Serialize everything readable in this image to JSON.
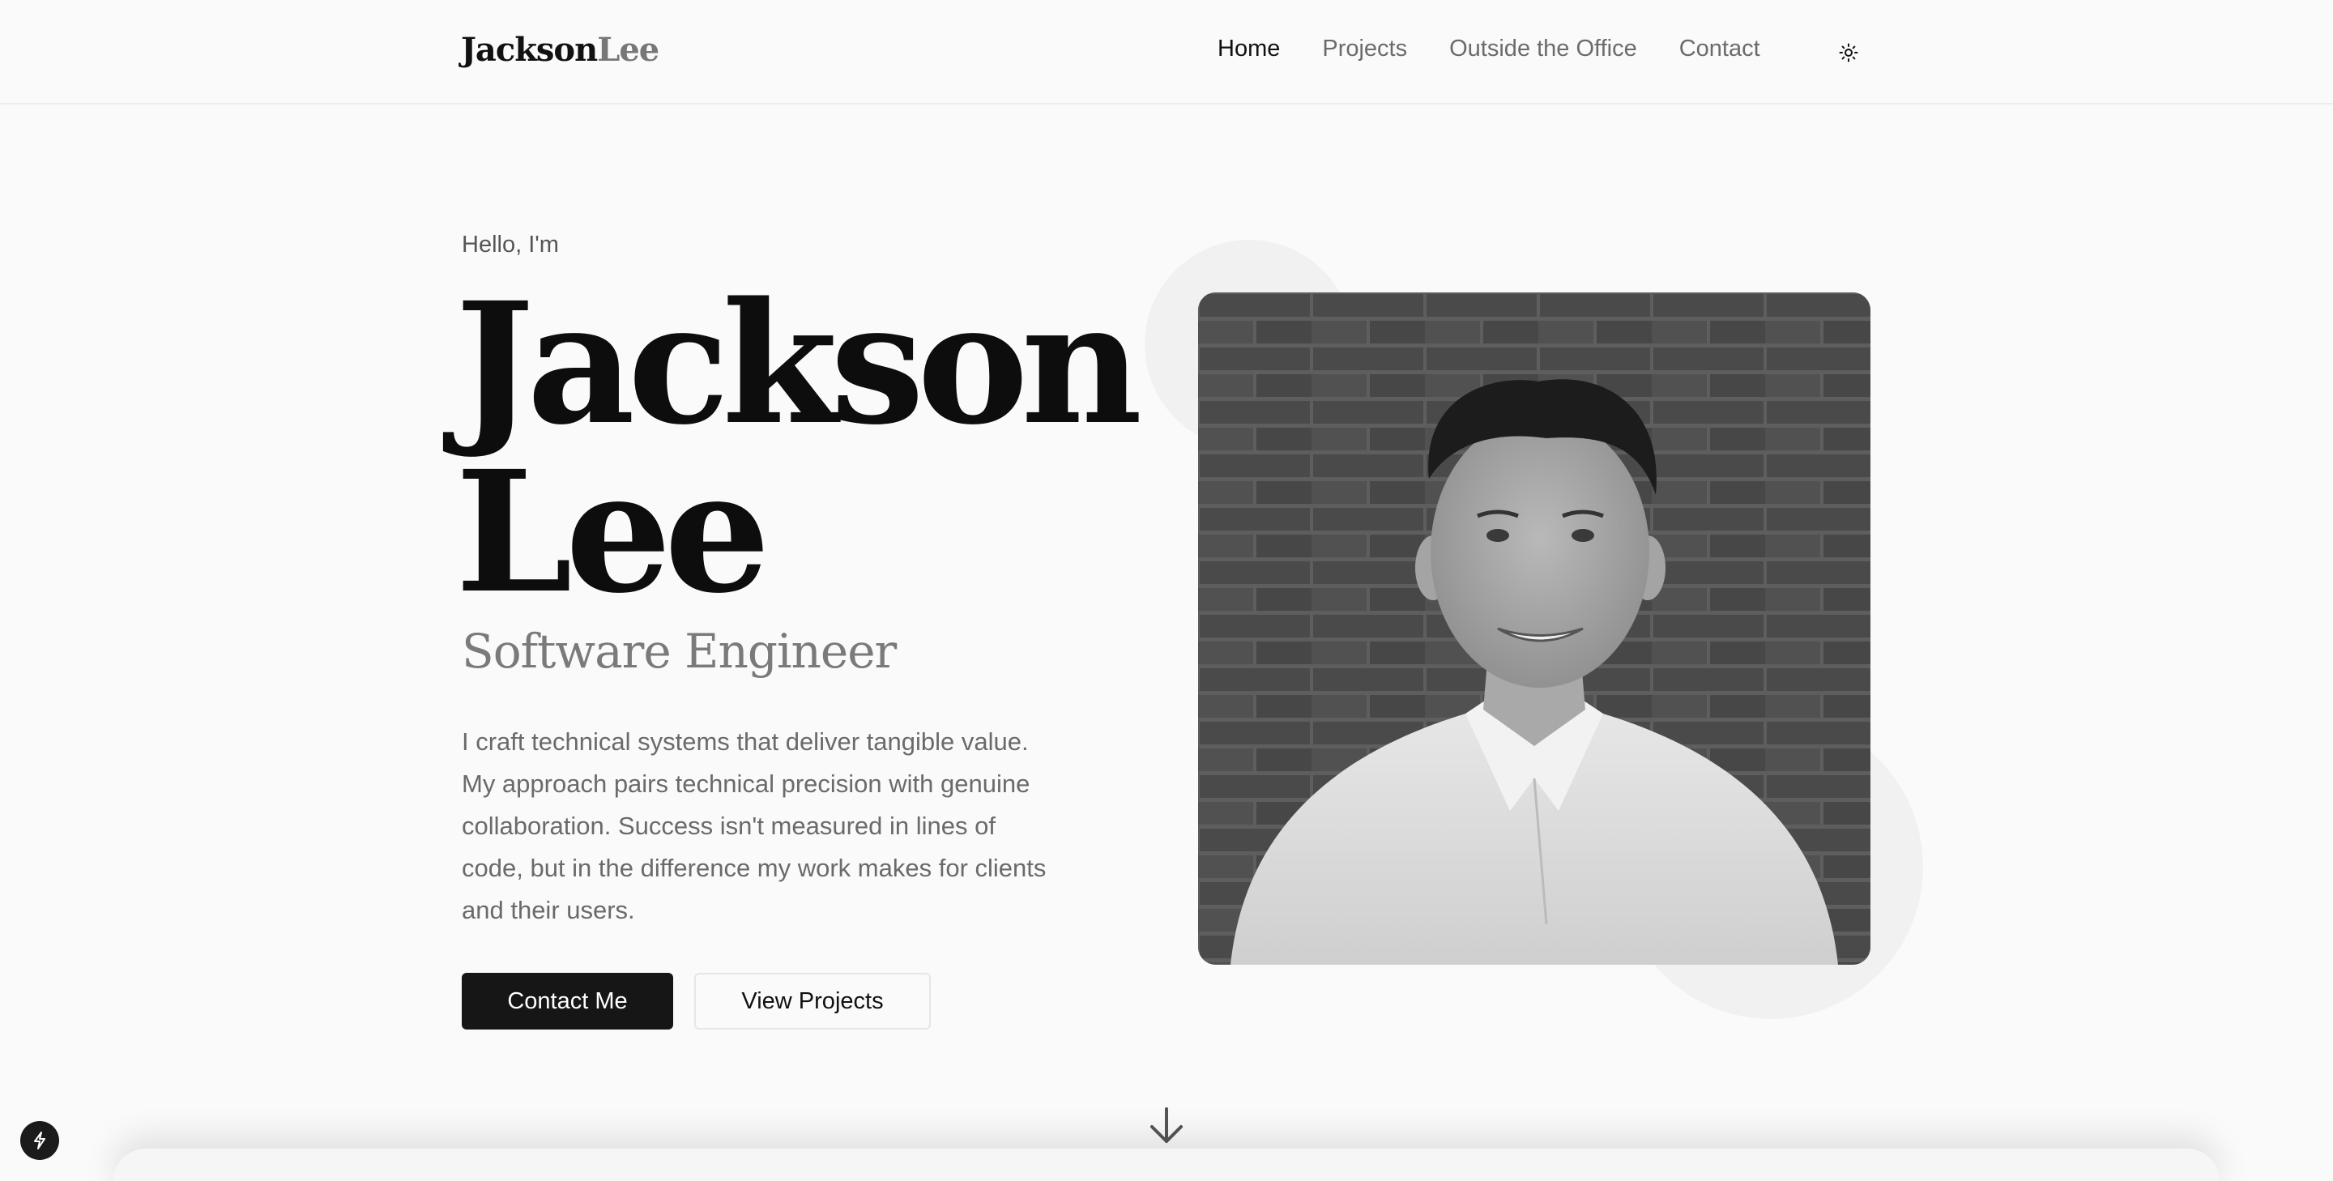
{
  "header": {
    "logo_first": "Jackson",
    "logo_last": "Lee",
    "nav": [
      {
        "label": "Home",
        "active": true
      },
      {
        "label": "Projects",
        "active": false
      },
      {
        "label": "Outside the Office",
        "active": false
      },
      {
        "label": "Contact",
        "active": false
      }
    ],
    "theme_icon": "sun-icon"
  },
  "hero": {
    "greeting": "Hello, I'm",
    "name_line1": "Jackson",
    "name_line2": "Lee",
    "role": "Software Engineer",
    "bio": "I craft technical systems that deliver tangible value. My approach pairs technical precision with genuine collaboration. Success isn't measured in lines of code, but in the difference my work makes for clients and their users.",
    "primary_cta": "Contact Me",
    "secondary_cta": "View Projects",
    "photo_alt": "Jackson Lee portrait"
  },
  "scroll_icon": "arrow-down-icon",
  "dev_badge_icon": "lightning-icon",
  "colors": {
    "background": "#fafafa",
    "text": "#111111",
    "muted": "#6a6a6a",
    "primary_button": "#161616"
  }
}
